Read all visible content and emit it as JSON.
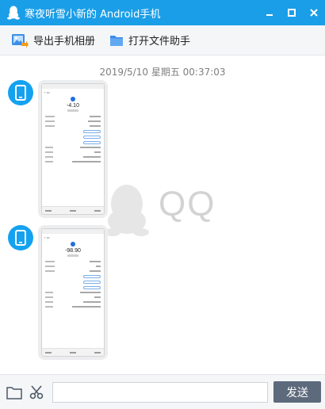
{
  "window": {
    "title": "寒夜听雪小新的 Android手机",
    "accent_color": "#1a9ee8",
    "controls": [
      "minimize-icon",
      "maximize-icon",
      "close-icon"
    ]
  },
  "toolbar": {
    "export_album_label": "导出手机相册",
    "open_file_helper_label": "打开文件助手",
    "export_icon": "photo-export-icon",
    "folder_icon": "folder-icon"
  },
  "chat": {
    "timestamp": "2019/5/10 星期五 00:37:03",
    "watermark": "QQ",
    "messages": [
      {
        "sender_icon": "phone-icon",
        "type": "image",
        "content": "screenshot",
        "amount": "-4.10"
      },
      {
        "sender_icon": "phone-icon",
        "type": "image",
        "content": "screenshot",
        "amount": "-98.90"
      }
    ]
  },
  "inputbar": {
    "folder_icon": "folder-icon",
    "scissors_icon": "scissors-icon",
    "input_value": "",
    "send_label": "发送",
    "send_color": "#5d6a7c"
  }
}
